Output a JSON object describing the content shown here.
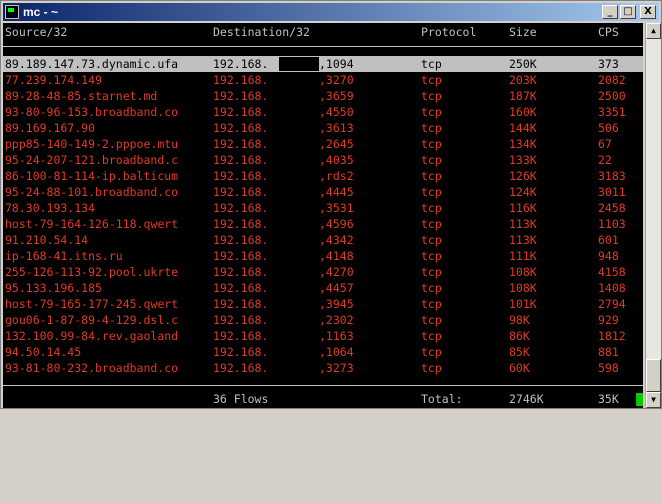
{
  "window": {
    "title": "mc - ~",
    "minimize_label": "_",
    "maximize_label": "□",
    "close_label": "X"
  },
  "table": {
    "headers": {
      "source": "Source/32",
      "destination": "Destination/32",
      "protocol": "Protocol",
      "size": "Size",
      "cps": "CPS"
    },
    "rows": [
      {
        "source": "89.189.147.73.dynamic.ufa",
        "destination": "192.168.",
        "port": ",1094",
        "protocol": "tcp",
        "size": "250K",
        "cps": "373",
        "selected": true
      },
      {
        "source": "77.239.174.149",
        "destination": "192.168.",
        "port": ",3270",
        "protocol": "tcp",
        "size": "203K",
        "cps": "2082"
      },
      {
        "source": "89-28-48-85.starnet.md",
        "destination": "192.168.",
        "port": ",3659",
        "protocol": "tcp",
        "size": "187K",
        "cps": "2500"
      },
      {
        "source": "93-80-96-153.broadband.co",
        "destination": "192.168.",
        "port": ",4550",
        "protocol": "tcp",
        "size": "160K",
        "cps": "3351"
      },
      {
        "source": "89.169.167.90",
        "destination": "192.168.",
        "port": ",3613",
        "protocol": "tcp",
        "size": "144K",
        "cps": "506"
      },
      {
        "source": "ppp85-140-149-2.pppoe.mtu",
        "destination": "192.168.",
        "port": ",2645",
        "protocol": "tcp",
        "size": "134K",
        "cps": "67"
      },
      {
        "source": "95-24-207-121.broadband.c",
        "destination": "192.168.",
        "port": ",4035",
        "protocol": "tcp",
        "size": "133K",
        "cps": "22"
      },
      {
        "source": "86-100-81-114-ip.balticum",
        "destination": "192.168.",
        "port": ",rds2",
        "protocol": "tcp",
        "size": "126K",
        "cps": "3183"
      },
      {
        "source": "95-24-88-101.broadband.co",
        "destination": "192.168.",
        "port": ",4445",
        "protocol": "tcp",
        "size": "124K",
        "cps": "3011"
      },
      {
        "source": "78.30.193.134",
        "destination": "192.168.",
        "port": ",3531",
        "protocol": "tcp",
        "size": "116K",
        "cps": "2458"
      },
      {
        "source": "host-79-164-126-118.qwert",
        "destination": "192.168.",
        "port": ",4596",
        "protocol": "tcp",
        "size": "113K",
        "cps": "1103"
      },
      {
        "source": "91.210.54.14",
        "destination": "192.168.",
        "port": ",4342",
        "protocol": "tcp",
        "size": "113K",
        "cps": "601"
      },
      {
        "source": "ip-168-41.itns.ru",
        "destination": "192.168.",
        "port": ",4148",
        "protocol": "tcp",
        "size": "111K",
        "cps": "948"
      },
      {
        "source": "255-126-113-92.pool.ukrte",
        "destination": "192.168.",
        "port": ",4270",
        "protocol": "tcp",
        "size": "108K",
        "cps": "4158"
      },
      {
        "source": "95.133.196.185",
        "destination": "192.168.",
        "port": ",4457",
        "protocol": "tcp",
        "size": "108K",
        "cps": "1408"
      },
      {
        "source": "host-79-165-177-245.qwert",
        "destination": "192.168.",
        "port": ",3945",
        "protocol": "tcp",
        "size": "101K",
        "cps": "2794"
      },
      {
        "source": "gou06-1-87-89-4-129.dsl.c",
        "destination": "192.168.",
        "port": ",2302",
        "protocol": "tcp",
        "size": "98K",
        "cps": "929"
      },
      {
        "source": "132.100.99-84.rev.gaoland",
        "destination": "192.168.",
        "port": ",1163",
        "protocol": "tcp",
        "size": "86K",
        "cps": "1812"
      },
      {
        "source": "94.50.14.45",
        "destination": "192.168.",
        "port": ",1064",
        "protocol": "tcp",
        "size": "85K",
        "cps": "881"
      },
      {
        "source": "93-81-80-232.broadband.co",
        "destination": "192.168.",
        "port": ",3273",
        "protocol": "tcp",
        "size": "60K",
        "cps": "598"
      }
    ]
  },
  "footer": {
    "flows": "36 Flows",
    "total_label": "Total:",
    "total_size": "2746K",
    "total_cps": "35K"
  },
  "colors": {
    "data_text": "#e03b26",
    "header_text": "#c0c0c0",
    "selected_bg": "#c0c0c0",
    "cursor": "#00cc00",
    "titlebar_start": "#0a246a"
  }
}
